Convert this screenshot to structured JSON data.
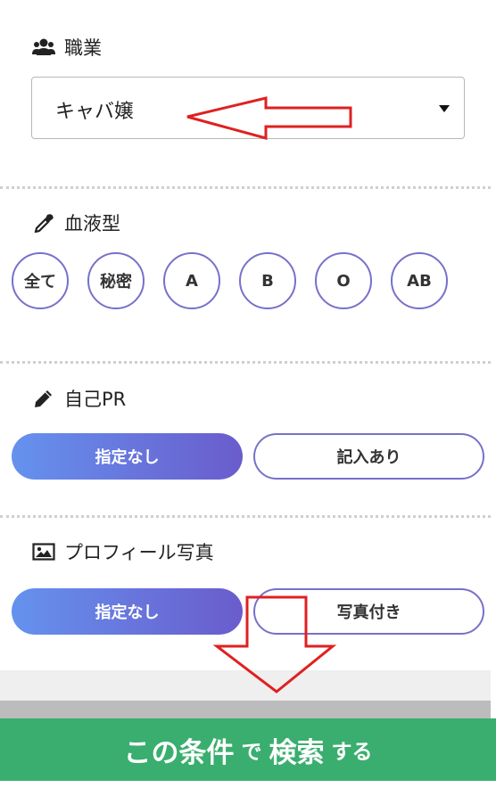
{
  "occupation": {
    "title": "職業",
    "selected": "キャバ嬢"
  },
  "blood_type": {
    "title": "血液型",
    "options": [
      "全て",
      "秘密",
      "A",
      "B",
      "O",
      "AB"
    ]
  },
  "self_pr": {
    "title": "自己PR",
    "options": [
      "指定なし",
      "記入あり"
    ]
  },
  "profile_photo": {
    "title": "プロフィール写真",
    "options": [
      "指定なし",
      "写真付き"
    ]
  },
  "search_button": {
    "part1": "この条件",
    "part2": "で",
    "part3": "検索",
    "part4": "する"
  },
  "colors": {
    "accent_border": "#7771c9",
    "gradient_start": "#6592ee",
    "gradient_end": "#6a5ccc",
    "search_green": "#3aae6e",
    "annotation_red": "#e02020"
  },
  "icons": [
    "users-icon",
    "dropper-icon",
    "pencil-icon",
    "image-icon",
    "caret-down-icon"
  ]
}
